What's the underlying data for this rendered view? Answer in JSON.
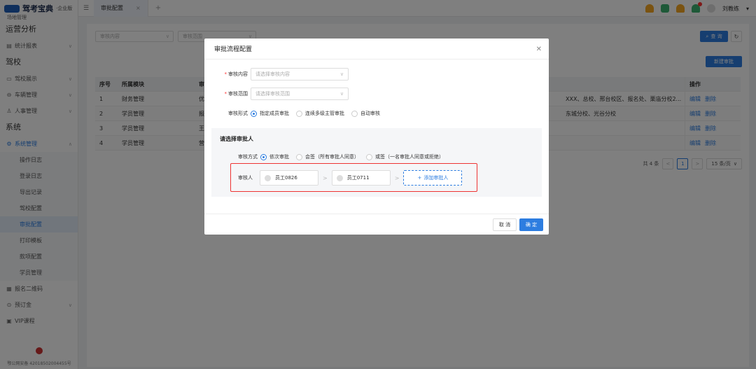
{
  "app": {
    "logo_text": "驾考宝典",
    "logo_sub": "·企业版",
    "partial_menu": "场地管理"
  },
  "sidebar": {
    "sections": [
      {
        "title": "运营分析",
        "items": [
          {
            "label": "统计报表",
            "icon": "chart-icon"
          }
        ]
      },
      {
        "title": "驾校",
        "items": [
          {
            "label": "驾校展示",
            "icon": "display-icon"
          },
          {
            "label": "车辆管理",
            "icon": "car-icon"
          },
          {
            "label": "人事管理",
            "icon": "person-icon"
          }
        ]
      },
      {
        "title": "系统",
        "items": [
          {
            "label": "系统管理",
            "icon": "gear-icon"
          }
        ]
      }
    ],
    "system_sub": [
      "操作日志",
      "登录日志",
      "导出记录",
      "驾校配置",
      "审批配置",
      "打印模板",
      "款项配置",
      "学员管理"
    ],
    "active_sub": "审批配置",
    "bottom_items": [
      {
        "label": "报名二维码",
        "icon": "qrcode-icon"
      },
      {
        "label": "预订金",
        "icon": "deposit-icon"
      },
      {
        "label": "VIP课程",
        "icon": "vip-icon"
      }
    ],
    "footer": "鄂公网安备 42018502004455号"
  },
  "topbar": {
    "tab_label": "审批配置",
    "user_name": "刘教练"
  },
  "main": {
    "filter_content_placeholder": "审核内容",
    "filter_scope_placeholder": "审核范围",
    "query_label": "查 询",
    "new_label": "新建审批",
    "table": {
      "headers": [
        "序号",
        "所属模块",
        "审",
        "",
        "操作"
      ],
      "rows": [
        {
          "no": "1",
          "module": "财务管理",
          "c3": "优",
          "c4": "XXX、总校、邢台校区、报名处、栗庙分校2...",
          "edit": "编辑",
          "del": "删除"
        },
        {
          "no": "2",
          "module": "学员管理",
          "c3": "报",
          "c4": "东城分校、光谷分校",
          "edit": "编辑",
          "del": "删除"
        },
        {
          "no": "3",
          "module": "学员管理",
          "c3": "王",
          "c4": "",
          "edit": "编辑",
          "del": "删除"
        },
        {
          "no": "4",
          "module": "学员管理",
          "c3": "营",
          "c4": "",
          "edit": "编辑",
          "del": "删除"
        }
      ]
    },
    "pager": {
      "total": "共 4 条",
      "current": "1",
      "page_size": "15 条/页"
    }
  },
  "modal": {
    "title": "审批流程配置",
    "content_label": "审核内容",
    "content_placeholder": "请选择审核内容",
    "scope_label": "审核范围",
    "scope_placeholder": "请选择审核范围",
    "form_label": "审核形式",
    "form_options": [
      "指定成员审批",
      "连续多级主管审批",
      "自动审核"
    ],
    "form_selected": 0,
    "approver_section_title": "请选择审批人",
    "method_label": "审核方式",
    "method_options": [
      "依次审批",
      "会签（所有审批人同意）",
      "或签（一名审批人同意或拒绝）"
    ],
    "method_selected": 0,
    "approver_label": "审核人",
    "approvers": [
      "员工0826",
      "员工0711"
    ],
    "add_approver_label": "添加审批人",
    "cancel_label": "取 消",
    "ok_label": "确 定"
  },
  "colors": {
    "primary": "#2d7de0",
    "highlight_box": "#e33333",
    "required": "#ff3333"
  }
}
